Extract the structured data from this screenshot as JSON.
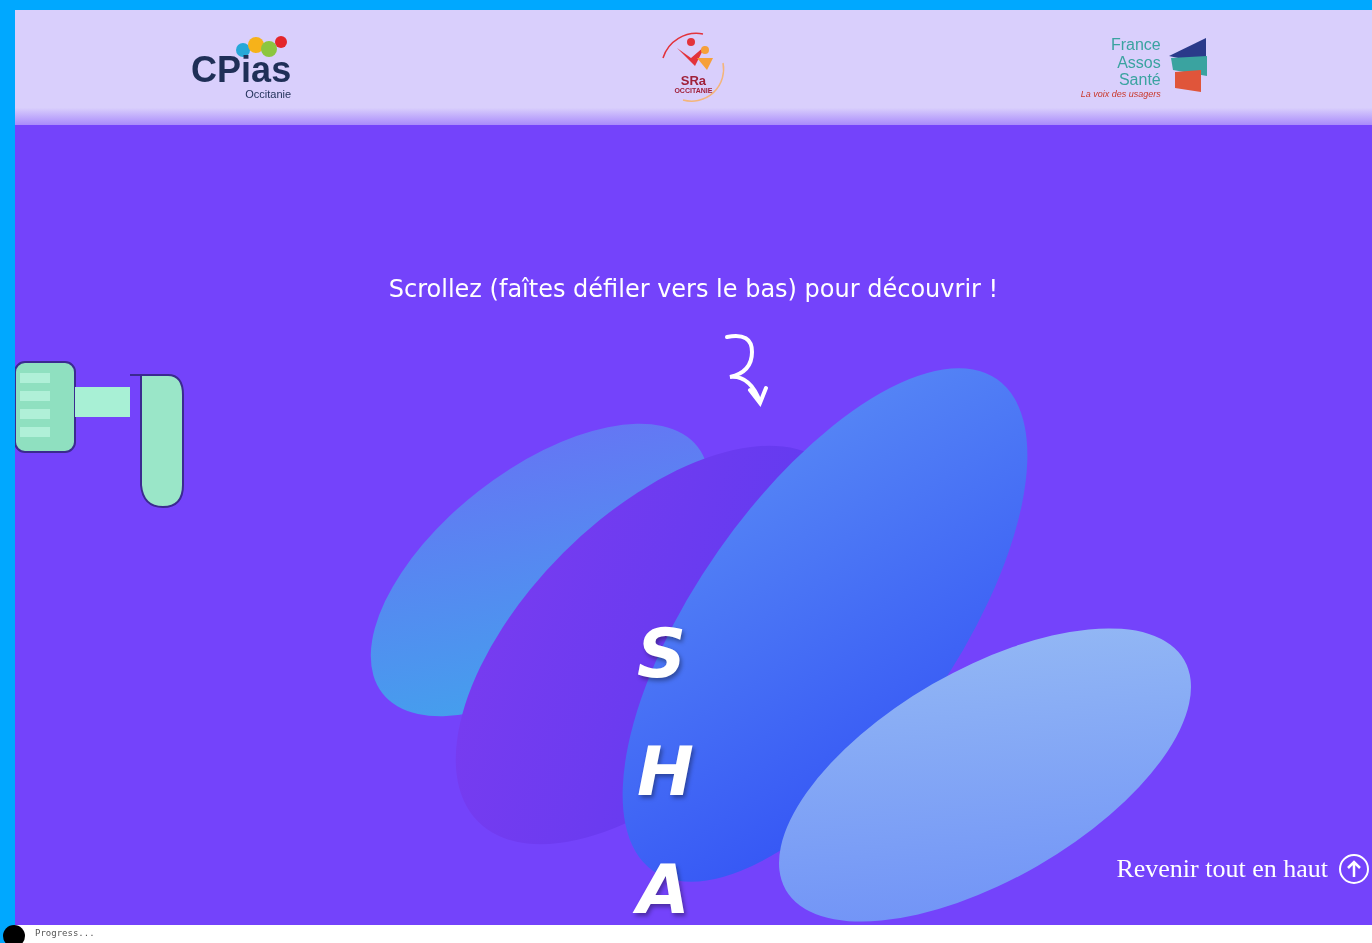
{
  "header": {
    "logos": [
      {
        "kind": "cpias",
        "name": "CPias",
        "subtitle": "Occitanie"
      },
      {
        "kind": "sra",
        "name": "SRa",
        "subtitle": "OCCITANIE"
      },
      {
        "kind": "fas",
        "lines": [
          "France",
          "Assos",
          "Santé"
        ],
        "tagline": "La voix des usagers"
      }
    ]
  },
  "hero": {
    "instruction": "Scrollez (faîtes défiler vers le bas) pour découvrir !",
    "title": "SHA"
  },
  "back_to_top": {
    "label": "Revenir tout en haut"
  },
  "progress": {
    "label": "Progress..."
  }
}
